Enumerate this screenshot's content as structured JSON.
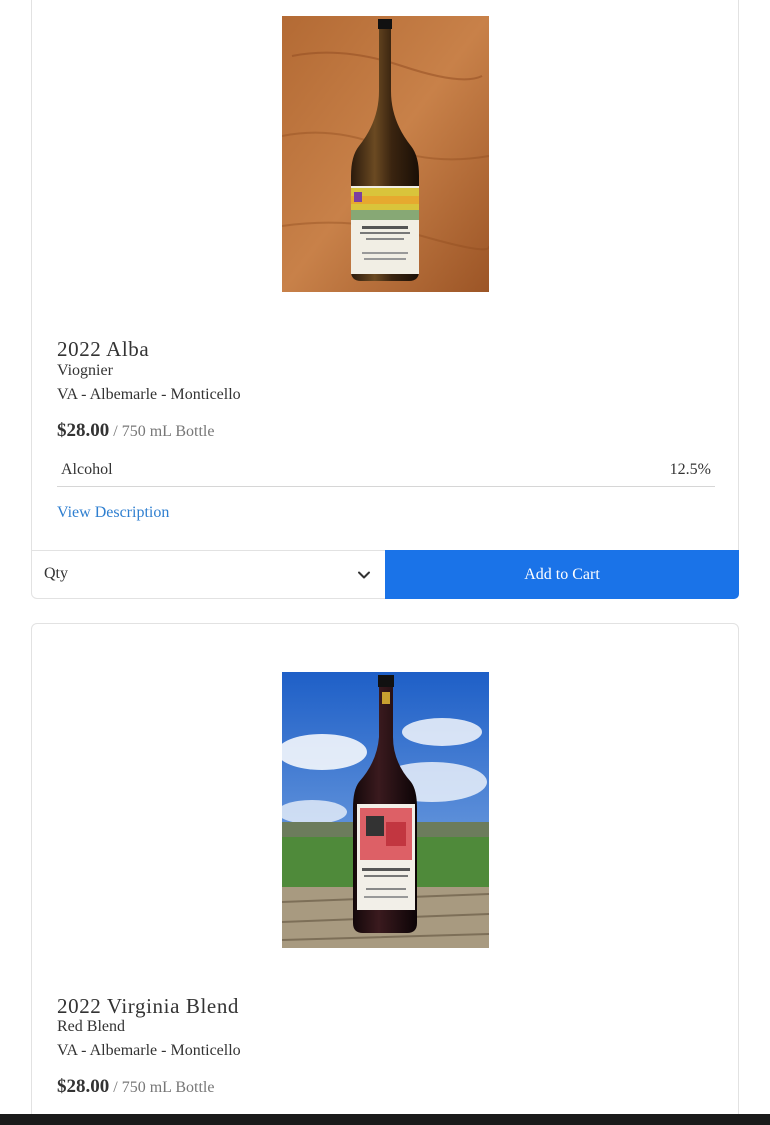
{
  "products": [
    {
      "title": "2022 Alba",
      "varietal": "Viognier",
      "region": "VA - Albemarle - Monticello",
      "price": "$28.00",
      "unit": "/ 750 mL Bottle",
      "image_icon": "wine-bottle-photo",
      "attributes": [
        {
          "label": "Alcohol",
          "value": "12.5%"
        }
      ],
      "view_description_label": "View Description",
      "qty_label": "Qty",
      "add_to_cart_label": "Add to Cart"
    },
    {
      "title": "2022 Virginia Blend",
      "varietal": "Red Blend",
      "region": "VA - Albemarle - Monticello",
      "price": "$28.00",
      "unit": "/ 750 mL Bottle",
      "image_icon": "wine-bottle-photo"
    }
  ],
  "colors": {
    "accent": "#1a73e8",
    "link": "#2f7fd0",
    "text": "#333333",
    "muted": "#777777"
  }
}
